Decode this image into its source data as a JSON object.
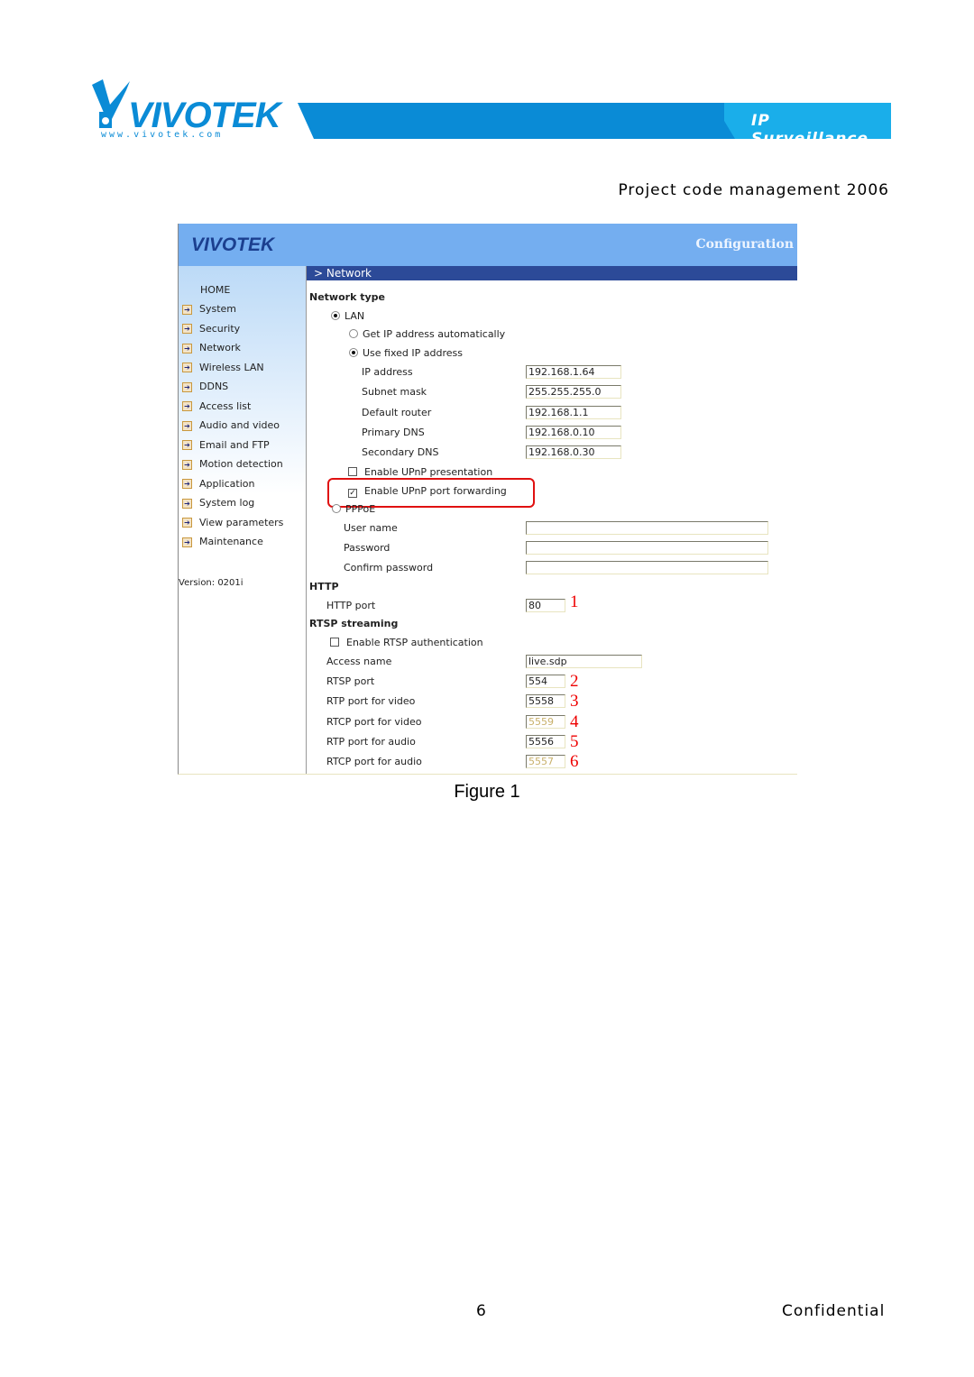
{
  "banner": {
    "brand": "VIVOTEK",
    "url": "www.vivotek.com",
    "tagline": "IP Surveillance",
    "brand_color": "#0a8bd6"
  },
  "project_line": "Project code management 2006",
  "screenshot": {
    "header": {
      "brand": "VIVOTEK",
      "title": "Configuration"
    },
    "nav_title": "> Network",
    "sidebar": {
      "home": "HOME",
      "items": [
        "System",
        "Security",
        "Network",
        "Wireless LAN",
        "DDNS",
        "Access list",
        "Audio and video",
        "Email and FTP",
        "Motion detection",
        "Application",
        "System log",
        "View parameters",
        "Maintenance"
      ],
      "version": "Version: 0201i"
    },
    "network_type": {
      "heading": "Network type",
      "lan": "LAN",
      "lan_selected": true,
      "auto_ip": "Get IP address automatically",
      "fixed_ip": "Use fixed IP address",
      "fixed_selected": true,
      "fields": [
        {
          "label": "IP address",
          "value": "192.168.1.64"
        },
        {
          "label": "Subnet mask",
          "value": "255.255.255.0"
        },
        {
          "label": "Default router",
          "value": "192.168.1.1"
        },
        {
          "label": "Primary DNS",
          "value": "192.168.0.10"
        },
        {
          "label": "Secondary DNS",
          "value": "192.168.0.30"
        }
      ],
      "upnp_presentation": {
        "label": "Enable UPnP presentation",
        "checked": false
      },
      "upnp_forwarding": {
        "label": "Enable UPnP port forwarding",
        "checked": true
      },
      "pppoe": "PPPoE",
      "pppoe_fields": [
        {
          "label": "User name",
          "value": ""
        },
        {
          "label": "Password",
          "value": ""
        },
        {
          "label": "Confirm password",
          "value": ""
        }
      ]
    },
    "http": {
      "heading": "HTTP",
      "port_label": "HTTP port",
      "port": "80",
      "marker": "1"
    },
    "rtsp": {
      "heading": "RTSP streaming",
      "auth": {
        "label": "Enable RTSP authentication",
        "checked": false
      },
      "access_label": "Access name",
      "access_name": "live.sdp",
      "ports": [
        {
          "label": "RTSP port",
          "value": "554",
          "marker": "2"
        },
        {
          "label": "RTP port for video",
          "value": "5558",
          "marker": "3"
        },
        {
          "label": "RTCP port for video",
          "value": "5559",
          "marker": "4",
          "disabled": true
        },
        {
          "label": "RTP port for audio",
          "value": "5556",
          "marker": "5"
        },
        {
          "label": "RTCP port for audio",
          "value": "5557",
          "marker": "6",
          "disabled": true
        }
      ]
    }
  },
  "caption": "Figure 1",
  "footer": {
    "page": "6",
    "label": "Confidential"
  }
}
